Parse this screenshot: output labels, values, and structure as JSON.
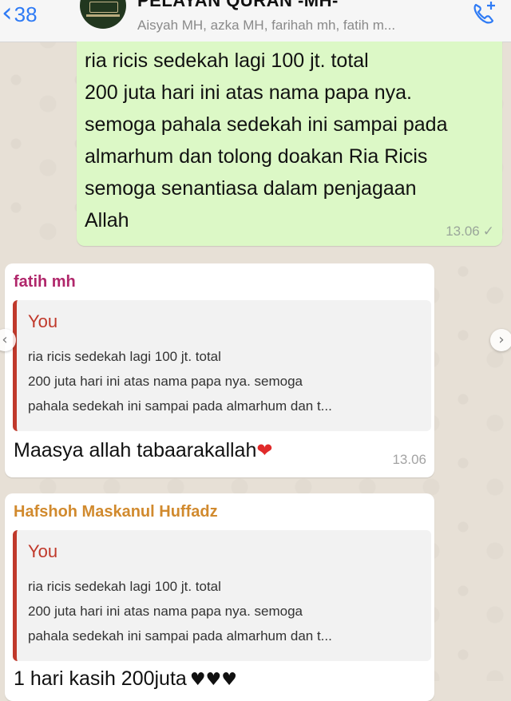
{
  "header": {
    "back_count": "38",
    "title": "PELAYAN QURAN -MH-",
    "members": "Aisyah MH, azka MH, farihah mh, fatih m..."
  },
  "outgoing": {
    "lines": [
      "ria ricis sedekah lagi 100 jt. total",
      "200 juta hari ini atas nama papa nya.",
      "semoga pahala sedekah ini sampai pada",
      "almarhum dan tolong doakan Ria Ricis",
      "semoga senantiasa dalam penjagaan",
      "Allah"
    ],
    "time": "13.06",
    "tick": "✓"
  },
  "replies": [
    {
      "sender": "fatih mh",
      "sender_color": "#b0276b",
      "quote_author": "You",
      "quote_lines": [
        "ria ricis sedekah lagi 100 jt. total",
        "200 juta hari ini atas nama papa nya. semoga",
        "pahala sedekah ini sampai pada almarhum dan t..."
      ],
      "text": "Maasya allah tabaarakallah",
      "emoji": "❤",
      "time": "13.06"
    },
    {
      "sender": "Hafshoh Maskanul Huffadz",
      "sender_color": "#d18a2e",
      "quote_author": "You",
      "quote_lines": [
        "ria ricis sedekah lagi 100 jt. total",
        "200 juta hari ini atas nama papa nya. semoga",
        "pahala sedekah ini sampai pada almarhum dan t..."
      ],
      "text": "1 hari kasih 200juta",
      "emoji": "♥♥♥"
    }
  ],
  "icons": {
    "back": "back-chevron-icon",
    "call": "add-call-icon",
    "prev": "chevron-left-icon",
    "next": "chevron-right-icon"
  },
  "colors": {
    "accent": "#2f7bf5",
    "outgoing_bubble": "#dcf8c6",
    "quote_bar": "#c0392b"
  }
}
